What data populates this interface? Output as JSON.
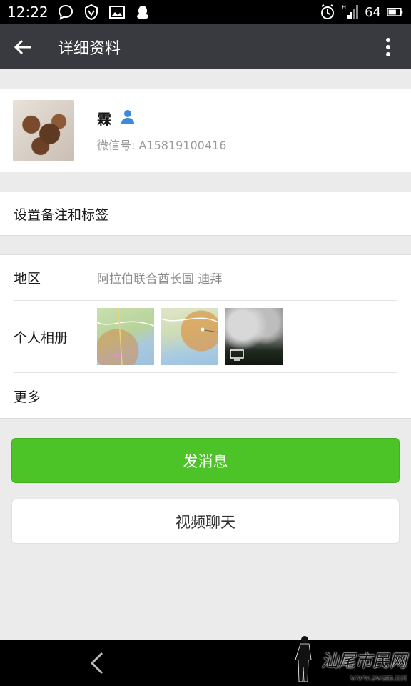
{
  "status_bar": {
    "time": "12:22",
    "network": "H",
    "battery": "64",
    "left_icons": [
      "chat-bubble-icon",
      "vpn-shield-icon",
      "image-icon",
      "qq-penguin-icon"
    ],
    "right_icons": [
      "alarm-icon",
      "signal-icon",
      "battery-icon"
    ]
  },
  "header": {
    "title": "详细资料"
  },
  "profile": {
    "name": "霖",
    "wechat_id": "微信号: A15819100416"
  },
  "remark": {
    "label": "设置备注和标签"
  },
  "details": {
    "region_label": "地区",
    "region_value": "阿拉伯联合酋长国  迪拜",
    "album_label": "个人相册",
    "more_label": "更多"
  },
  "actions": {
    "send_message": "发消息",
    "video_chat": "视频聊天"
  },
  "watermark": {
    "text": "汕尾市民网",
    "url": "www.swsm.net"
  },
  "colors": {
    "action_bar": "#393a3f",
    "primary_button": "#4cc428",
    "background": "#ebebeb"
  }
}
